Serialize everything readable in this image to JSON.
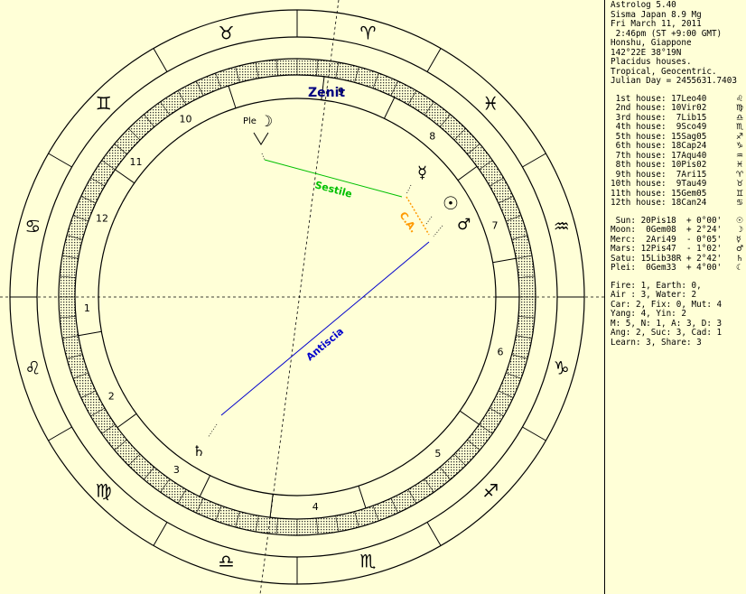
{
  "header": [
    "Astrolog 5.40",
    "Sisma Japan 8.9 Mg",
    "Fri March 11, 2011",
    " 2:46pm (ST +9:00 GMT)",
    "Honshu, Giappone",
    "142°22E 38°19N",
    "Placidus houses.",
    "Tropical, Geocentric.",
    "Julian Day = 2455631.7403"
  ],
  "houses": [
    {
      "text": " 1st house: 17Leo40",
      "glyph": "♌"
    },
    {
      "text": " 2nd house: 10Vir02",
      "glyph": "♍"
    },
    {
      "text": " 3rd house:  7Lib15",
      "glyph": "♎"
    },
    {
      "text": " 4th house:  9Sco49",
      "glyph": "♏"
    },
    {
      "text": " 5th house: 15Sag05",
      "glyph": "♐"
    },
    {
      "text": " 6th house: 18Cap24",
      "glyph": "♑"
    },
    {
      "text": " 7th house: 17Aqu40",
      "glyph": "♒"
    },
    {
      "text": " 8th house: 10Pis02",
      "glyph": "♓"
    },
    {
      "text": " 9th house:  7Ari15",
      "glyph": "♈"
    },
    {
      "text": "10th house:  9Tau49",
      "glyph": "♉"
    },
    {
      "text": "11th house: 15Gem05",
      "glyph": "♊"
    },
    {
      "text": "12th house: 18Can24",
      "glyph": "♋"
    }
  ],
  "planets": [
    {
      "text": " Sun: 20Pis18  + 0°00'",
      "glyph": "☉"
    },
    {
      "text": "Moon:  0Gem08  + 2°24'",
      "glyph": "☽"
    },
    {
      "text": "Merc:  2Ari49  - 0°05'",
      "glyph": "☿"
    },
    {
      "text": "Mars: 12Pis47  - 1°02'",
      "glyph": "♂"
    },
    {
      "text": "Satu: 15Lib38R + 2°42'",
      "glyph": "♄"
    },
    {
      "text": "Plei:  0Gem33  + 4°00'",
      "glyph": "☾"
    }
  ],
  "elements": [
    "Fire: 1, Earth: 0,",
    "Air : 3, Water: 2",
    "Car: 2, Fix: 0, Mut: 4",
    "Yang: 4, Yin: 2",
    "M: 5, N: 1, A: 3, D: 3",
    "Ang: 2, Suc: 3, Cad: 1",
    "Learn: 3, Share: 3"
  ],
  "chart": {
    "signs": [
      {
        "glyph": "♉",
        "deg": 105
      },
      {
        "glyph": "♊",
        "deg": 135
      },
      {
        "glyph": "♋",
        "deg": 165
      },
      {
        "glyph": "♌",
        "deg": 195
      },
      {
        "glyph": "♍",
        "deg": 225
      },
      {
        "glyph": "♎",
        "deg": 255
      },
      {
        "glyph": "♏",
        "deg": 285
      },
      {
        "glyph": "♐",
        "deg": 315
      },
      {
        "glyph": "♑",
        "deg": 345
      },
      {
        "glyph": "♒",
        "deg": 15
      },
      {
        "glyph": "♓",
        "deg": 45
      },
      {
        "glyph": "♈",
        "deg": 75
      }
    ],
    "house_numbers": [
      {
        "n": "10",
        "deg": 122
      },
      {
        "n": "9",
        "deg": 78
      },
      {
        "n": "8",
        "deg": 50
      },
      {
        "n": "7",
        "deg": 20
      },
      {
        "n": "6",
        "deg": 345
      },
      {
        "n": "5",
        "deg": 312
      },
      {
        "n": "4",
        "deg": 275
      },
      {
        "n": "3",
        "deg": 235
      },
      {
        "n": "2",
        "deg": 208
      },
      {
        "n": "1",
        "deg": 183
      },
      {
        "n": "12",
        "deg": 158
      },
      {
        "n": "11",
        "deg": 140
      }
    ],
    "planet_labels": {
      "pleiades": "Ple",
      "moon": "☽",
      "mercury": "☿",
      "sun": "☉",
      "mars": "♂",
      "saturn": "♄"
    },
    "labels": {
      "zenit": "Zenit",
      "sestile": "Sestile",
      "ca": "C.A.",
      "antiscia": "Antiscia"
    },
    "colors": {
      "sestile": "#00c000",
      "ca": "#ff9900",
      "antiscia": "#0000cc",
      "zenit": "#000080",
      "background": "#ffffd7"
    }
  }
}
